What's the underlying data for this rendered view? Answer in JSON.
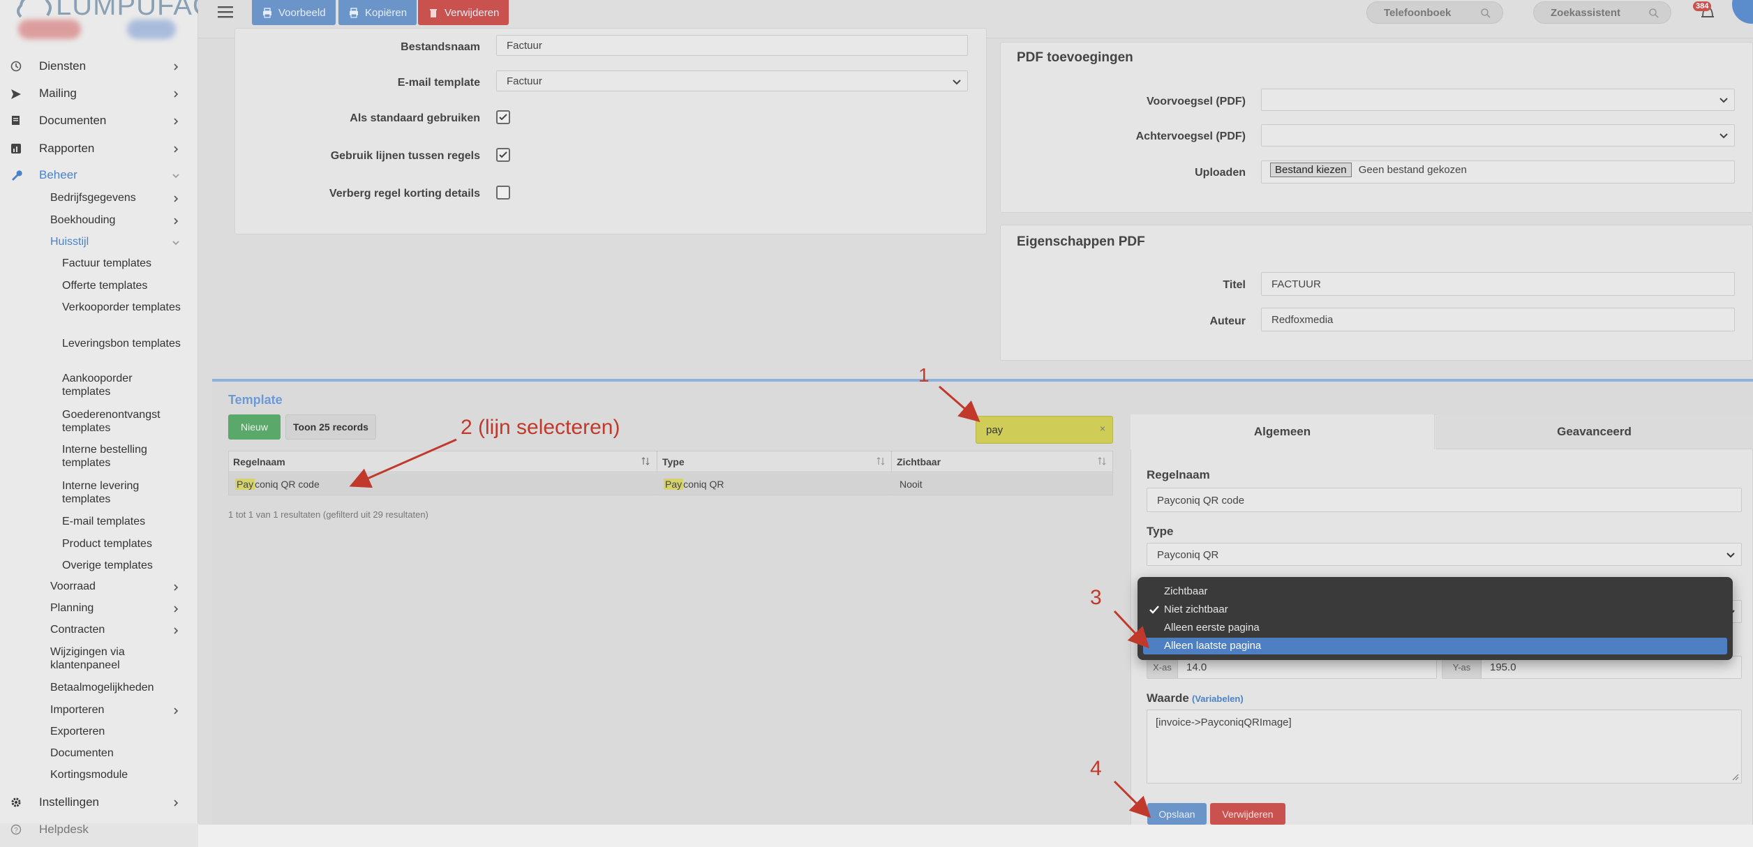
{
  "app": {
    "logo_text": "LUMPUFACT"
  },
  "topbar": {
    "buttons": {
      "preview": "Voorbeeld",
      "copy": "Kopiëren",
      "delete": "Verwijderen"
    },
    "phonebook": "Telefoonboek",
    "search_assistant": "Zoekassistent",
    "notification_count": "384",
    "colors": {
      "primary": "#4a82c8",
      "danger": "#d9534f"
    }
  },
  "sidebar": {
    "items": [
      {
        "label": "Diensten",
        "icon": "history-icon"
      },
      {
        "label": "Mailing",
        "icon": "send-icon"
      },
      {
        "label": "Documenten",
        "icon": "documents-icon"
      },
      {
        "label": "Rapporten",
        "icon": "chart-icon"
      },
      {
        "label": "Beheer",
        "icon": "wrench-icon"
      }
    ],
    "beheer_sub": [
      "Bedrijfsgegevens",
      "Boekhouding",
      "Huisstijl"
    ],
    "huisstijl_sub": [
      "Factuur templates",
      "Offerte templates",
      "Verkooporder templates",
      "Leveringsbon templates",
      "Aankooporder templates",
      "Goederenontvangst templates",
      "Interne bestelling templates",
      "Interne levering templates",
      "E-mail templates",
      "Product templates",
      "Overige templates"
    ],
    "beheer_sub2": [
      "Voorraad",
      "Planning",
      "Contracten",
      "Wijzigingen via klantenpaneel",
      "Betaalmogelijkheden",
      "Importeren",
      "Exporteren",
      "Documenten",
      "Kortingsmodule"
    ],
    "settings": "Instellingen",
    "helpdesk": "Helpdesk"
  },
  "form_left": {
    "filename_label": "Bestandsnaam",
    "filename_value": "Factuur",
    "email_template_label": "E-mail template",
    "email_template_value": "Factuur",
    "default_label": "Als standaard gebruiken",
    "default_checked": true,
    "lines_label": "Gebruik lijnen tussen regels",
    "lines_checked": true,
    "hide_discount_label": "Verberg regel korting details",
    "hide_discount_checked": false
  },
  "pdf_additions": {
    "title": "PDF toevoegingen",
    "prefix_label": "Voorvoegsel (PDF)",
    "suffix_label": "Achtervoegsel (PDF)",
    "upload_label": "Uploaden",
    "upload_button": "Bestand kiezen",
    "upload_status": "Geen bestand gekozen"
  },
  "pdf_properties": {
    "title": "Eigenschappen PDF",
    "title_label": "Titel",
    "title_value": "FACTUUR",
    "author_label": "Auteur",
    "author_value": "Redfoxmedia"
  },
  "template": {
    "section_title": "Template",
    "new_button": "Nieuw",
    "show_records_button": "Toon 25 records",
    "search_value": "pay",
    "columns": [
      "Regelnaam",
      "Type",
      "Zichtbaar"
    ],
    "rows": [
      {
        "name_hl": "Pay",
        "name_rest": "coniq QR code",
        "type_hl": "Pay",
        "type_rest": "coniq QR",
        "visible": "Nooit"
      }
    ],
    "info": "1 tot 1 van 1 resultaten (gefilterd uit 29 resultaten)"
  },
  "detail": {
    "tab_general": "Algemeen",
    "tab_advanced": "Geavanceerd",
    "rulename_label": "Regelnaam",
    "rulename_value": "Payconiq QR code",
    "type_label": "Type",
    "type_value": "Payconiq QR",
    "xas_label": "X-as",
    "xas_value": "14.0",
    "yas_label": "Y-as",
    "yas_value": "195.0",
    "value_label": "Waarde",
    "variables_link": "(Variabelen)",
    "value_text": "[invoice->PayconiqQRImage]",
    "save_button": "Opslaan",
    "delete_button": "Verwijderen"
  },
  "visibility_dropdown": {
    "options": [
      "Zichtbaar",
      "Niet zichtbaar",
      "Alleen eerste pagina",
      "Alleen laatste pagina"
    ],
    "checked": "Niet zichtbaar",
    "highlighted": "Alleen laatste pagina"
  },
  "annotations": {
    "a1": "1",
    "a2": "2 (lijn selecteren)",
    "a3": "3",
    "a4": "4",
    "color": "#c0392b"
  }
}
